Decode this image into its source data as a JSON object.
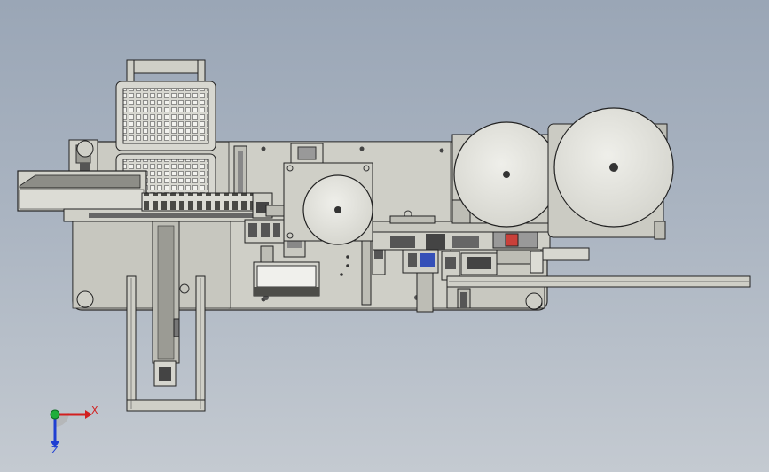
{
  "window": {
    "background_top": "#9aa6b6",
    "background_bottom": "#c4cad1"
  },
  "colors": {
    "part_fill": "#cfcfc7",
    "part_light": "#dcdcd5",
    "part_dark": "#7b7b76",
    "edge": "#2a2a2a",
    "accent_red": "#c9403a",
    "accent_blue": "#3550b8"
  },
  "triad": {
    "x_label": "X",
    "z_label": "Z",
    "x_color": "#d21f1f",
    "y_color": "#1fae3a",
    "z_color": "#1f3fd2"
  },
  "icons": [
    "coordinate-triad-icon"
  ]
}
